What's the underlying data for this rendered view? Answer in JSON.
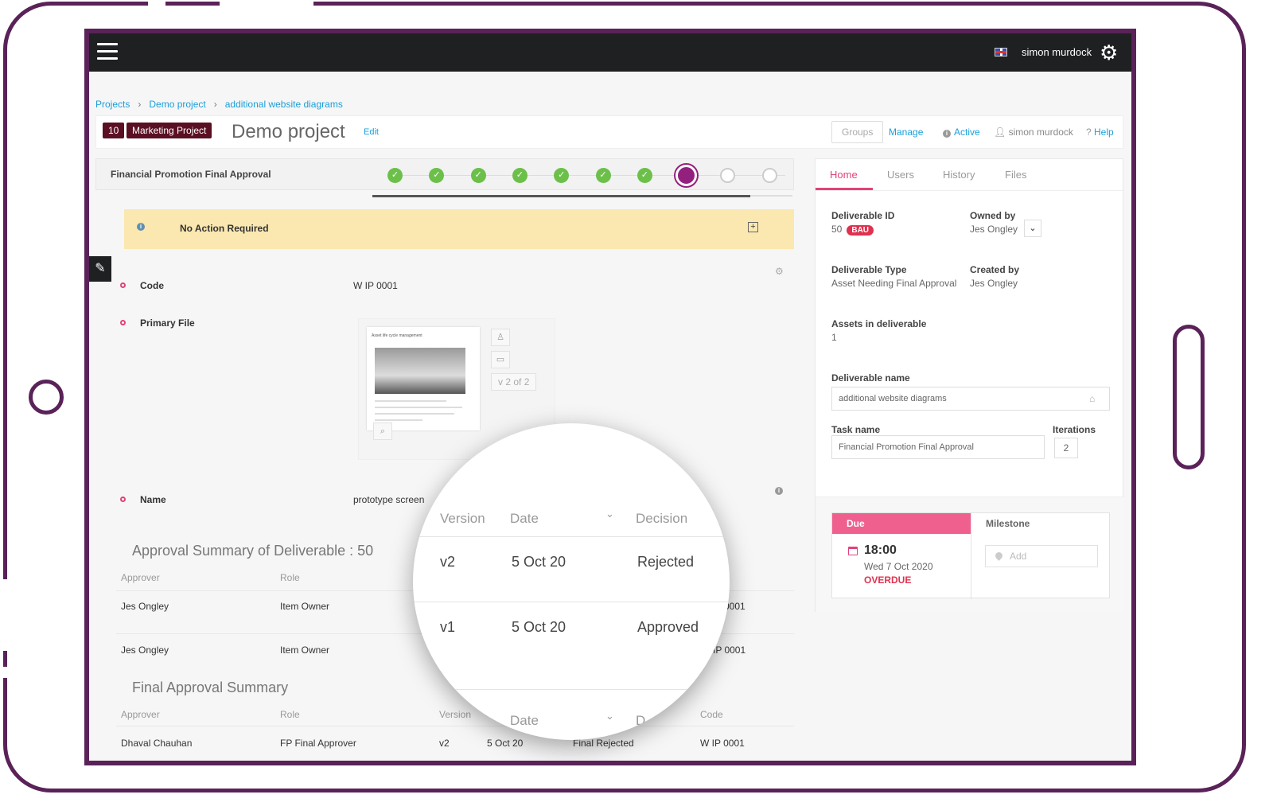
{
  "topbar": {
    "user": "simon murdock"
  },
  "breadcrumb": [
    "Projects",
    "Demo project",
    "additional website diagrams"
  ],
  "project": {
    "number": "10",
    "type": "Marketing Project",
    "title": "Demo project",
    "edit_label": "Edit",
    "groups_label": "Groups",
    "manage_label": "Manage",
    "status": "Active",
    "owner": "simon murdock",
    "help_label": "Help"
  },
  "workflow": {
    "title": "Financial Promotion Final Approval",
    "steps": [
      "done",
      "done",
      "done",
      "done",
      "done",
      "done",
      "done",
      "current",
      "todo",
      "todo"
    ],
    "progress_fraction": 0.9
  },
  "alert": {
    "text": "No Action Required"
  },
  "fields": {
    "code_label": "Code",
    "code_value": "W IP 0001",
    "primary_file_label": "Primary File",
    "name_label": "Name",
    "name_value": "prototype screen"
  },
  "file_preview": {
    "versions": "2 of 2",
    "thumb_heading": "Asset life cycle management"
  },
  "approval_summary": {
    "title": "Approval Summary of Deliverable : 50",
    "headers": {
      "approver": "Approver",
      "role": "Role"
    },
    "rows": [
      {
        "approver": "Jes Ongley",
        "role": "Item Owner",
        "code": "0001"
      },
      {
        "approver": "Jes Ongley",
        "role": "Item Owner",
        "code": "IP 0001"
      }
    ]
  },
  "final_summary": {
    "title": "Final Approval Summary",
    "headers": {
      "approver": "Approver",
      "role": "Role",
      "version": "Version",
      "code": "Code"
    },
    "rows": [
      {
        "approver": "Dhaval Chauhan",
        "role": "FP Final Approver",
        "version": "v2",
        "date": "5 Oct 20",
        "decision": "Final Rejected",
        "code": "W IP 0001"
      }
    ]
  },
  "magnifier": {
    "headers": {
      "version": "Version",
      "date": "Date",
      "decision": "Decision"
    },
    "rows": [
      {
        "version": "v2",
        "date": "5 Oct 20",
        "decision": "Rejected"
      },
      {
        "version": "v1",
        "date": "5 Oct 20",
        "decision": "Approved"
      }
    ],
    "footer": {
      "date": "Date",
      "decision": "D"
    }
  },
  "panel": {
    "tabs": [
      "Home",
      "Users",
      "History",
      "Files"
    ],
    "deliverable_id_label": "Deliverable ID",
    "deliverable_id": "50",
    "bau": "BAU",
    "owned_by_label": "Owned by",
    "owned_by": "Jes Ongley",
    "deliverable_type_label": "Deliverable Type",
    "deliverable_type": "Asset Needing Final Approval",
    "created_by_label": "Created by",
    "created_by": "Jes Ongley",
    "assets_label": "Assets in deliverable",
    "assets": "1",
    "deliverable_name_label": "Deliverable name",
    "deliverable_name": "additional website diagrams",
    "task_name_label": "Task name",
    "task_name": "Financial Promotion Final Approval",
    "iterations_label": "Iterations",
    "iterations": "2",
    "due_label": "Due",
    "milestone_label": "Milestone",
    "due_time": "18:00",
    "due_date": "Wed 7 Oct 2020",
    "overdue": "OVERDUE",
    "add_label": "Add"
  },
  "colors": {
    "accent": "#e0427a",
    "frame": "#5a2258",
    "link": "#1a9fd9",
    "done": "#6cc04a",
    "current": "#93207e"
  }
}
